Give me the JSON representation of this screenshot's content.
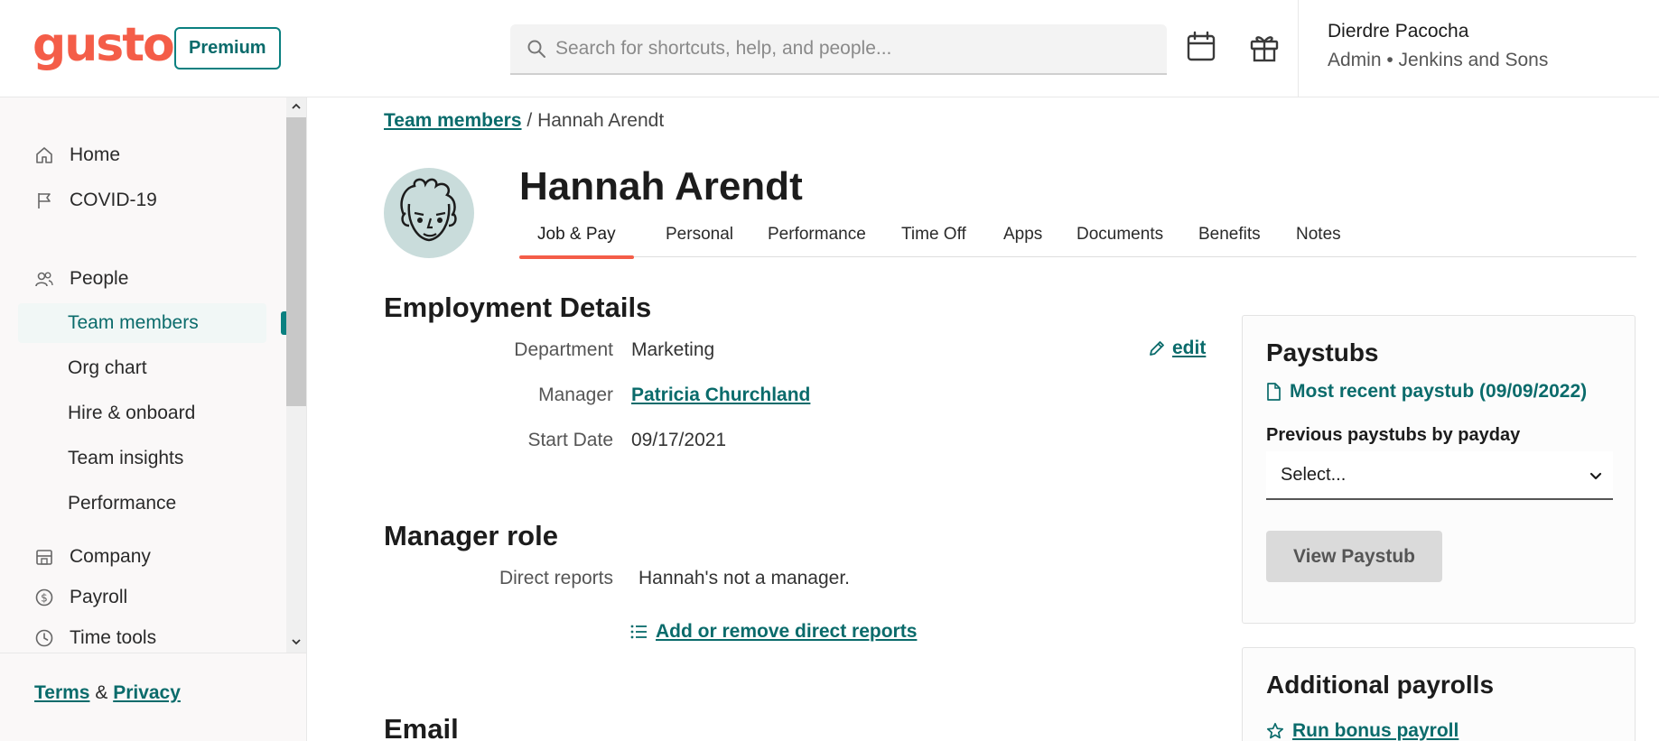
{
  "header": {
    "logo": "gusto",
    "plan_badge": "Premium",
    "search_placeholder": "Search for shortcuts, help, and people...",
    "icons": [
      "calendar-icon",
      "gift-icon",
      "search-icon"
    ],
    "user_name": "Dierdre Pacocha",
    "user_role": "Admin • Jenkins and Sons"
  },
  "sidebar": {
    "items": [
      {
        "label": "Home",
        "icon": "home-icon"
      },
      {
        "label": "COVID-19",
        "icon": "flag-icon"
      },
      {
        "label": "People",
        "icon": "people-icon"
      },
      {
        "label": "Team members",
        "active": true
      },
      {
        "label": "Org chart"
      },
      {
        "label": "Hire & onboard"
      },
      {
        "label": "Team insights"
      },
      {
        "label": "Performance"
      },
      {
        "label": "Company",
        "icon": "building-icon"
      },
      {
        "label": "Payroll",
        "icon": "dollar-icon"
      },
      {
        "label": "Time tools",
        "icon": "clock-icon"
      }
    ],
    "footer": {
      "terms": "Terms",
      "amp": "&",
      "privacy": "Privacy"
    }
  },
  "main": {
    "breadcrumb": {
      "parent": "Team members",
      "separator": "/",
      "current": "Hannah Arendt"
    },
    "person_name": "Hannah Arendt",
    "tabs": [
      "Job & Pay",
      "Personal",
      "Performance",
      "Time Off",
      "Apps",
      "Documents",
      "Benefits",
      "Notes"
    ],
    "active_tab": "Job & Pay",
    "employment": {
      "title": "Employment Details",
      "edit_label": "edit",
      "department_label": "Department",
      "department_value": "Marketing",
      "manager_label": "Manager",
      "manager_value": "Patricia Churchland",
      "start_label": "Start Date",
      "start_value": "09/17/2021"
    },
    "manager_role": {
      "title": "Manager role",
      "direct_label": "Direct reports",
      "direct_value": "Hannah's not a manager.",
      "add_link": "Add or remove direct reports"
    },
    "email_title": "Email"
  },
  "paystubs": {
    "title": "Paystubs",
    "recent_link": "Most recent paystub (09/09/2022)",
    "previous_label": "Previous paystubs by payday",
    "select_value": "Select...",
    "view_button": "View Paystub"
  },
  "additional": {
    "title": "Additional payrolls",
    "run_link": "Run bonus payroll"
  },
  "colors": {
    "brand": "#f45d48",
    "accent": "#0a8080",
    "link": "#0a6b6b"
  }
}
